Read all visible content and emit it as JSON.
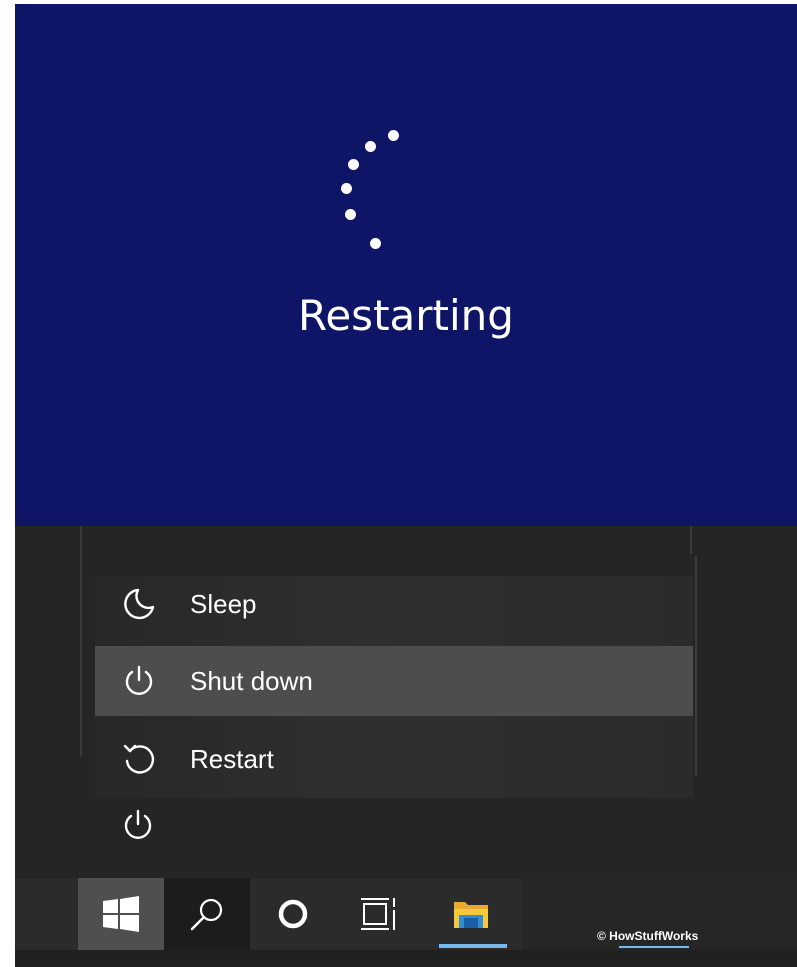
{
  "restart_screen": {
    "status_text": "Restarting",
    "background_color": "#0f1566",
    "spinner_icon": "loading-dots-spinner"
  },
  "power_menu": {
    "items": [
      {
        "label": "Sleep",
        "icon": "moon-icon"
      },
      {
        "label": "Shut down",
        "icon": "power-icon",
        "highlighted": true
      },
      {
        "label": "Restart",
        "icon": "restart-icon"
      }
    ],
    "power_button_icon": "power-icon",
    "highlight_color": "#4d4d4d"
  },
  "taskbar": {
    "buttons": [
      {
        "name": "start",
        "icon": "windows-logo-icon"
      },
      {
        "name": "search",
        "icon": "search-icon"
      },
      {
        "name": "cortana",
        "icon": "cortana-icon"
      },
      {
        "name": "task-view",
        "icon": "task-view-icon"
      },
      {
        "name": "file-explorer",
        "icon": "folder-icon",
        "active": true
      }
    ],
    "accent_color": "#76b9ed"
  },
  "watermark": {
    "text": "© HowStuffWorks"
  }
}
